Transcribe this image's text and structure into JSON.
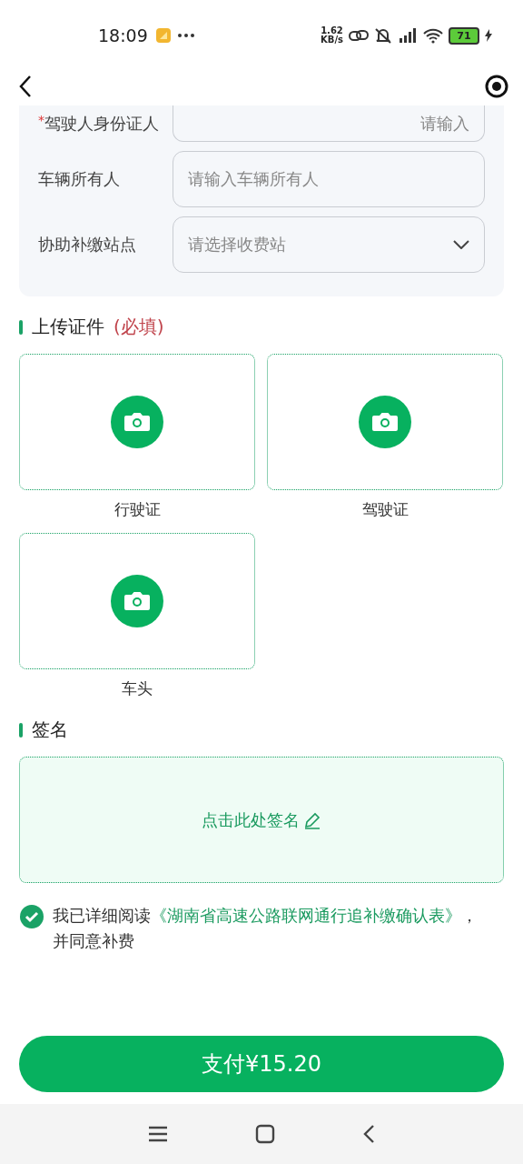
{
  "status_bar": {
    "time": "18:09",
    "network_speed": "1.62",
    "speed_unit": "KB/s",
    "battery": "71"
  },
  "form": {
    "fields": [
      {
        "kind": "text",
        "required_mark": "*",
        "label": "驾驶人身份证人",
        "placeholder": "请输入"
      },
      {
        "kind": "text",
        "label": "车辆所有人",
        "placeholder": "请输入车辆所有人"
      },
      {
        "kind": "select",
        "label": "协助补缴站点",
        "placeholder": "请选择收费站"
      }
    ]
  },
  "upload": {
    "title": "上传证件",
    "required_note": "(必填)",
    "slots": [
      {
        "caption": "行驶证"
      },
      {
        "caption": "驾驶证"
      },
      {
        "caption": "车头"
      }
    ]
  },
  "signature": {
    "title": "签名",
    "prompt": "点击此处签名"
  },
  "agreement": {
    "checked": true,
    "before": "我已详细阅读",
    "link": "《湖南省高速公路联网通行追补缴确认表》",
    "after": "，并同意补费"
  },
  "pay_button": "支付¥15.20"
}
